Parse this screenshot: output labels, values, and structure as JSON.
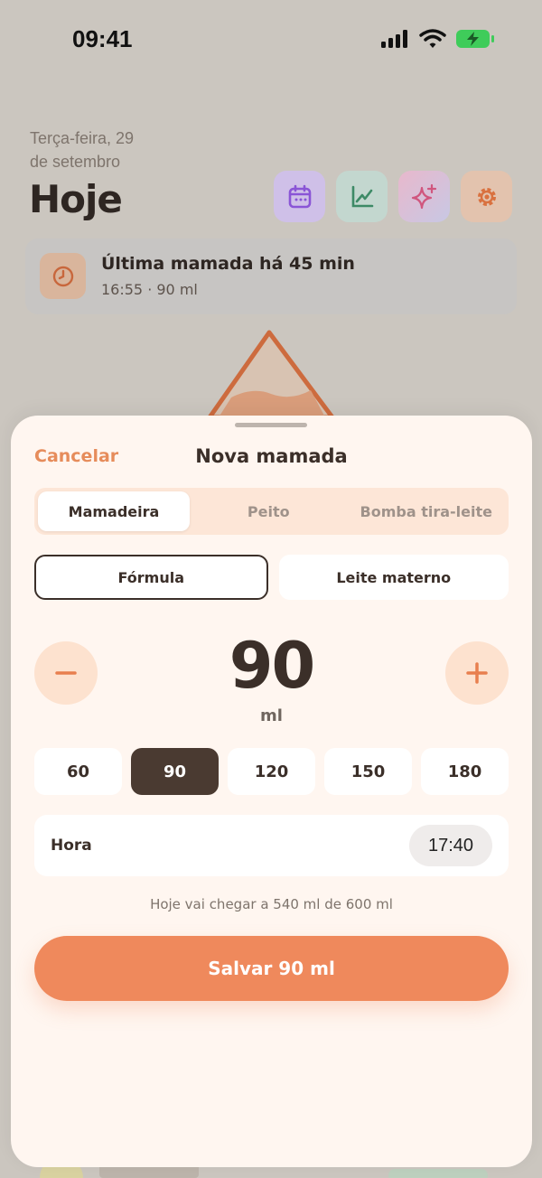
{
  "status_bar": {
    "time": "09:41"
  },
  "home": {
    "date_line1": "Terça-feira, 29",
    "date_line2": "de setembro",
    "title": "Hoje",
    "actions": [
      {
        "icon": "calendar-icon",
        "color": "#cfc0e8"
      },
      {
        "icon": "chart-icon",
        "color": "#c3d7cf"
      },
      {
        "icon": "sparkle-icon",
        "color": "#e6c0cf"
      },
      {
        "icon": "gear-icon",
        "color": "#e3c3ae"
      }
    ],
    "last_feed": {
      "title": "Última mamada há 45 min",
      "subtitle": "16:55 · 90 ml"
    }
  },
  "sheet": {
    "cancel_label": "Cancelar",
    "title": "Nova mamada",
    "modes": [
      "Mamadeira",
      "Peito",
      "Bomba tira-leite"
    ],
    "active_mode": "Mamadeira",
    "types": [
      "Fórmula",
      "Leite materno"
    ],
    "selected_type": "Fórmula",
    "amount": "90",
    "unit": "ml",
    "presets": [
      "60",
      "90",
      "120",
      "150",
      "180"
    ],
    "selected_preset": "90",
    "time_label": "Hora",
    "time_value": "17:40",
    "daily_note": "Hoje vai chegar a 540 ml de 600 ml",
    "save_label": "Salvar 90 ml"
  },
  "colors": {
    "accent": "#ef895c",
    "dark": "#3b2f29",
    "sheet_bg": "#fff6f0"
  }
}
